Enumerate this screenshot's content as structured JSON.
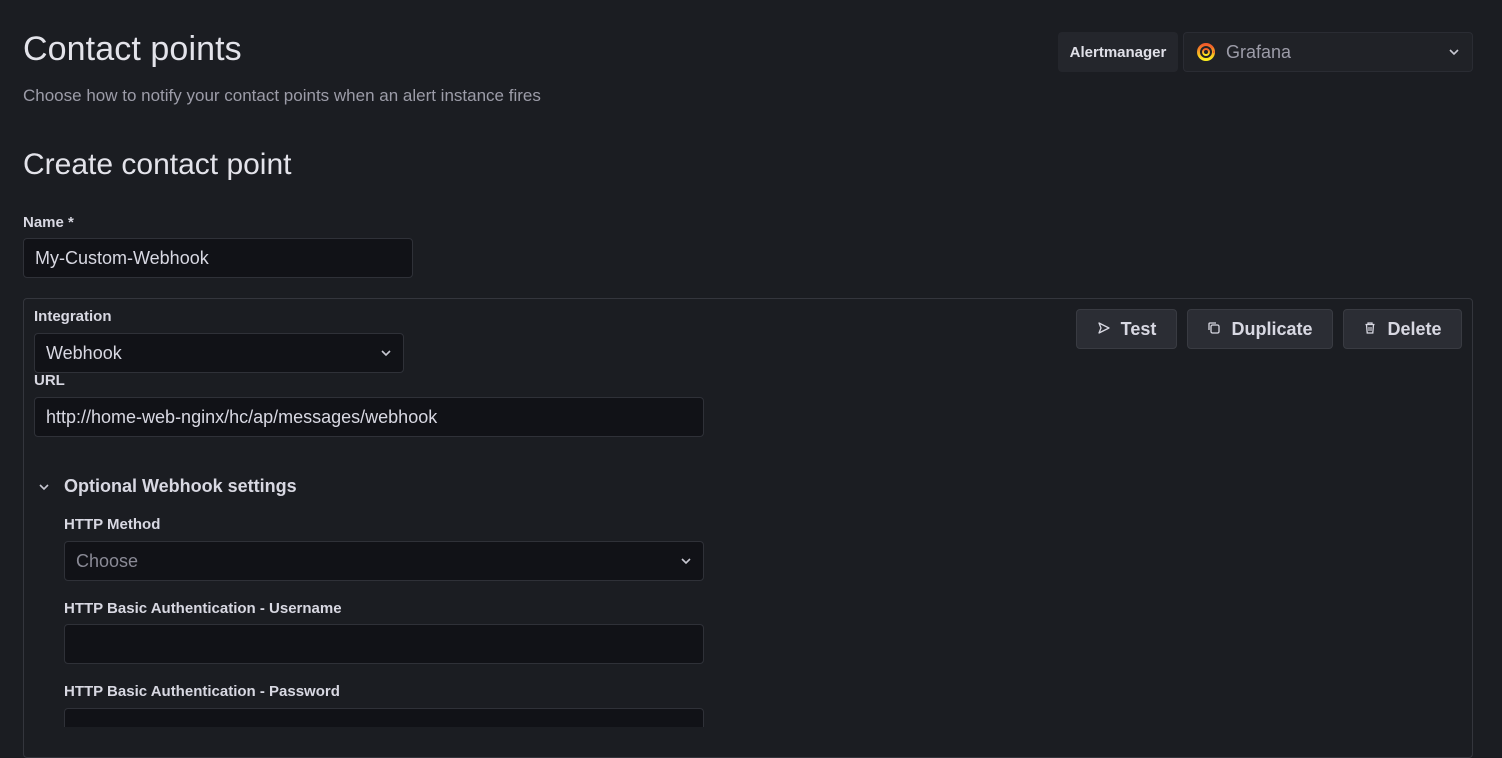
{
  "header": {
    "title": "Contact points",
    "subtitle": "Choose how to notify your contact points when an alert instance fires",
    "alertmanager_label": "Alertmanager",
    "alertmanager_value": "Grafana",
    "grafana_icon": "grafana-logo-icon"
  },
  "form": {
    "title": "Create contact point",
    "name_label": "Name *",
    "name_value": "My-Custom-Webhook",
    "integration": {
      "label": "Integration",
      "value": "Webhook",
      "url_label": "URL",
      "url_value": "http://home-web-nginx/hc/ap/messages/webhook",
      "buttons": {
        "test": "Test",
        "duplicate": "Duplicate",
        "delete": "Delete"
      },
      "optional_section": {
        "title": "Optional Webhook settings",
        "expanded": true,
        "http_method_label": "HTTP Method",
        "http_method_placeholder": "Choose",
        "username_label": "HTTP Basic Authentication - Username",
        "username_value": "",
        "password_label": "HTTP Basic Authentication - Password",
        "password_value": ""
      }
    }
  },
  "colors": {
    "background": "#1b1d22",
    "input_background": "#111217",
    "button_background": "#2b2d34",
    "grafana_orange": "#f46800"
  }
}
